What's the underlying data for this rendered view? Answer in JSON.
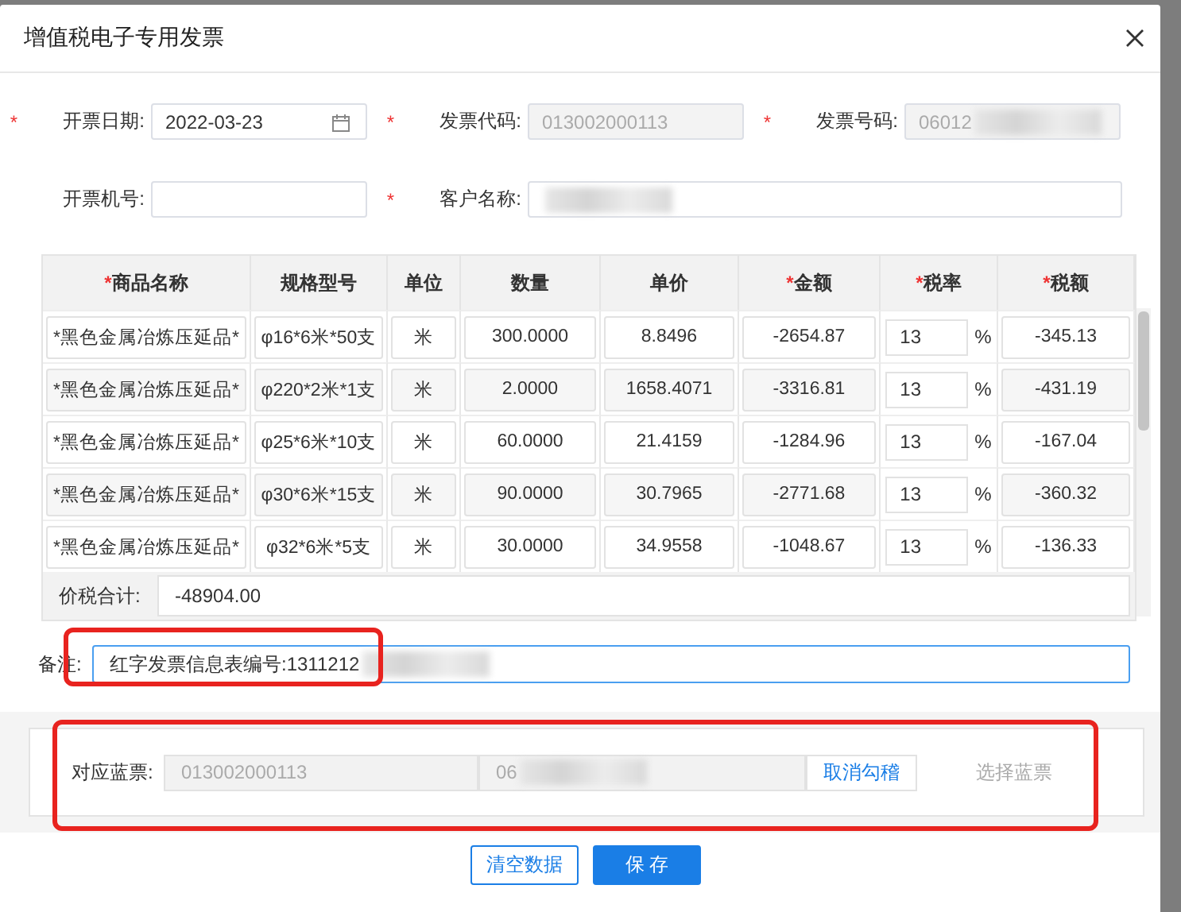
{
  "dialog": {
    "title": "增值税电子专用发票"
  },
  "form": [
    {
      "label": "开票日期:",
      "required_mark": "*",
      "kind": "date",
      "value": "2022-03-23",
      "disabled": false
    },
    {
      "label": "发票代码:",
      "required_mark": "*",
      "kind": "text",
      "value": "013002000113",
      "disabled": true
    },
    {
      "label": "发票号码:",
      "required_mark": "*",
      "kind": "text",
      "value": "06012",
      "disabled": true,
      "redacted": true
    },
    {
      "label": "开票机号:",
      "kind": "text",
      "disabled": false
    },
    {
      "label": "客户名称:",
      "required_mark": "*",
      "kind": "wide",
      "disabled": false,
      "redacted": true
    }
  ],
  "table": {
    "columns": [
      {
        "label": "商品名称",
        "required_mark": "*"
      },
      {
        "label": "规格型号"
      },
      {
        "label": "单位"
      },
      {
        "label": "数量"
      },
      {
        "label": "单价"
      },
      {
        "label": "金额",
        "required_mark": "*"
      },
      {
        "label": "税率",
        "required_mark": "*"
      },
      {
        "label": "税额",
        "required_mark": "*"
      }
    ],
    "rows": [
      {
        "name": "*黑色金属冶炼压延品*",
        "spec": "φ16*6米*50支",
        "unit": "米",
        "qty": "300.0000",
        "price": "8.8496",
        "amount": "-2654.87",
        "rate": "13",
        "rate_suffix": "%",
        "tax": "-345.13"
      },
      {
        "name": "*黑色金属冶炼压延品*",
        "spec": "φ220*2米*1支",
        "unit": "米",
        "qty": "2.0000",
        "price": "1658.4071",
        "amount": "-3316.81",
        "rate": "13",
        "rate_suffix": "%",
        "tax": "-431.19"
      },
      {
        "name": "*黑色金属冶炼压延品*",
        "spec": "φ25*6米*10支",
        "unit": "米",
        "qty": "60.0000",
        "price": "21.4159",
        "amount": "-1284.96",
        "rate": "13",
        "rate_suffix": "%",
        "tax": "-167.04"
      },
      {
        "name": "*黑色金属冶炼压延品*",
        "spec": "φ30*6米*15支",
        "unit": "米",
        "qty": "90.0000",
        "price": "30.7965",
        "amount": "-2771.68",
        "rate": "13",
        "rate_suffix": "%",
        "tax": "-360.32"
      },
      {
        "name": "*黑色金属冶炼压延品*",
        "spec": "φ32*6米*5支",
        "unit": "米",
        "qty": "30.0000",
        "price": "34.9558",
        "amount": "-1048.67",
        "rate": "13",
        "rate_suffix": "%",
        "tax": "-136.33"
      }
    ]
  },
  "total": {
    "label": "价税合计:",
    "value": "-48904.00"
  },
  "note": {
    "label": "备注:",
    "value": "红字发票信息表编号:1311212",
    "redacted": true,
    "highlighted": true
  },
  "blue_invoice": {
    "label": "对应蓝票:",
    "code": "013002000113",
    "number": "06",
    "redacted": true,
    "cancel_button": "取消勾稽",
    "select_link": {
      "label": "选择蓝票",
      "disabled": true
    },
    "highlighted": true
  },
  "buttons": [
    {
      "label": "清空数据",
      "primary": false
    },
    {
      "label": "保 存",
      "primary": true
    }
  ]
}
